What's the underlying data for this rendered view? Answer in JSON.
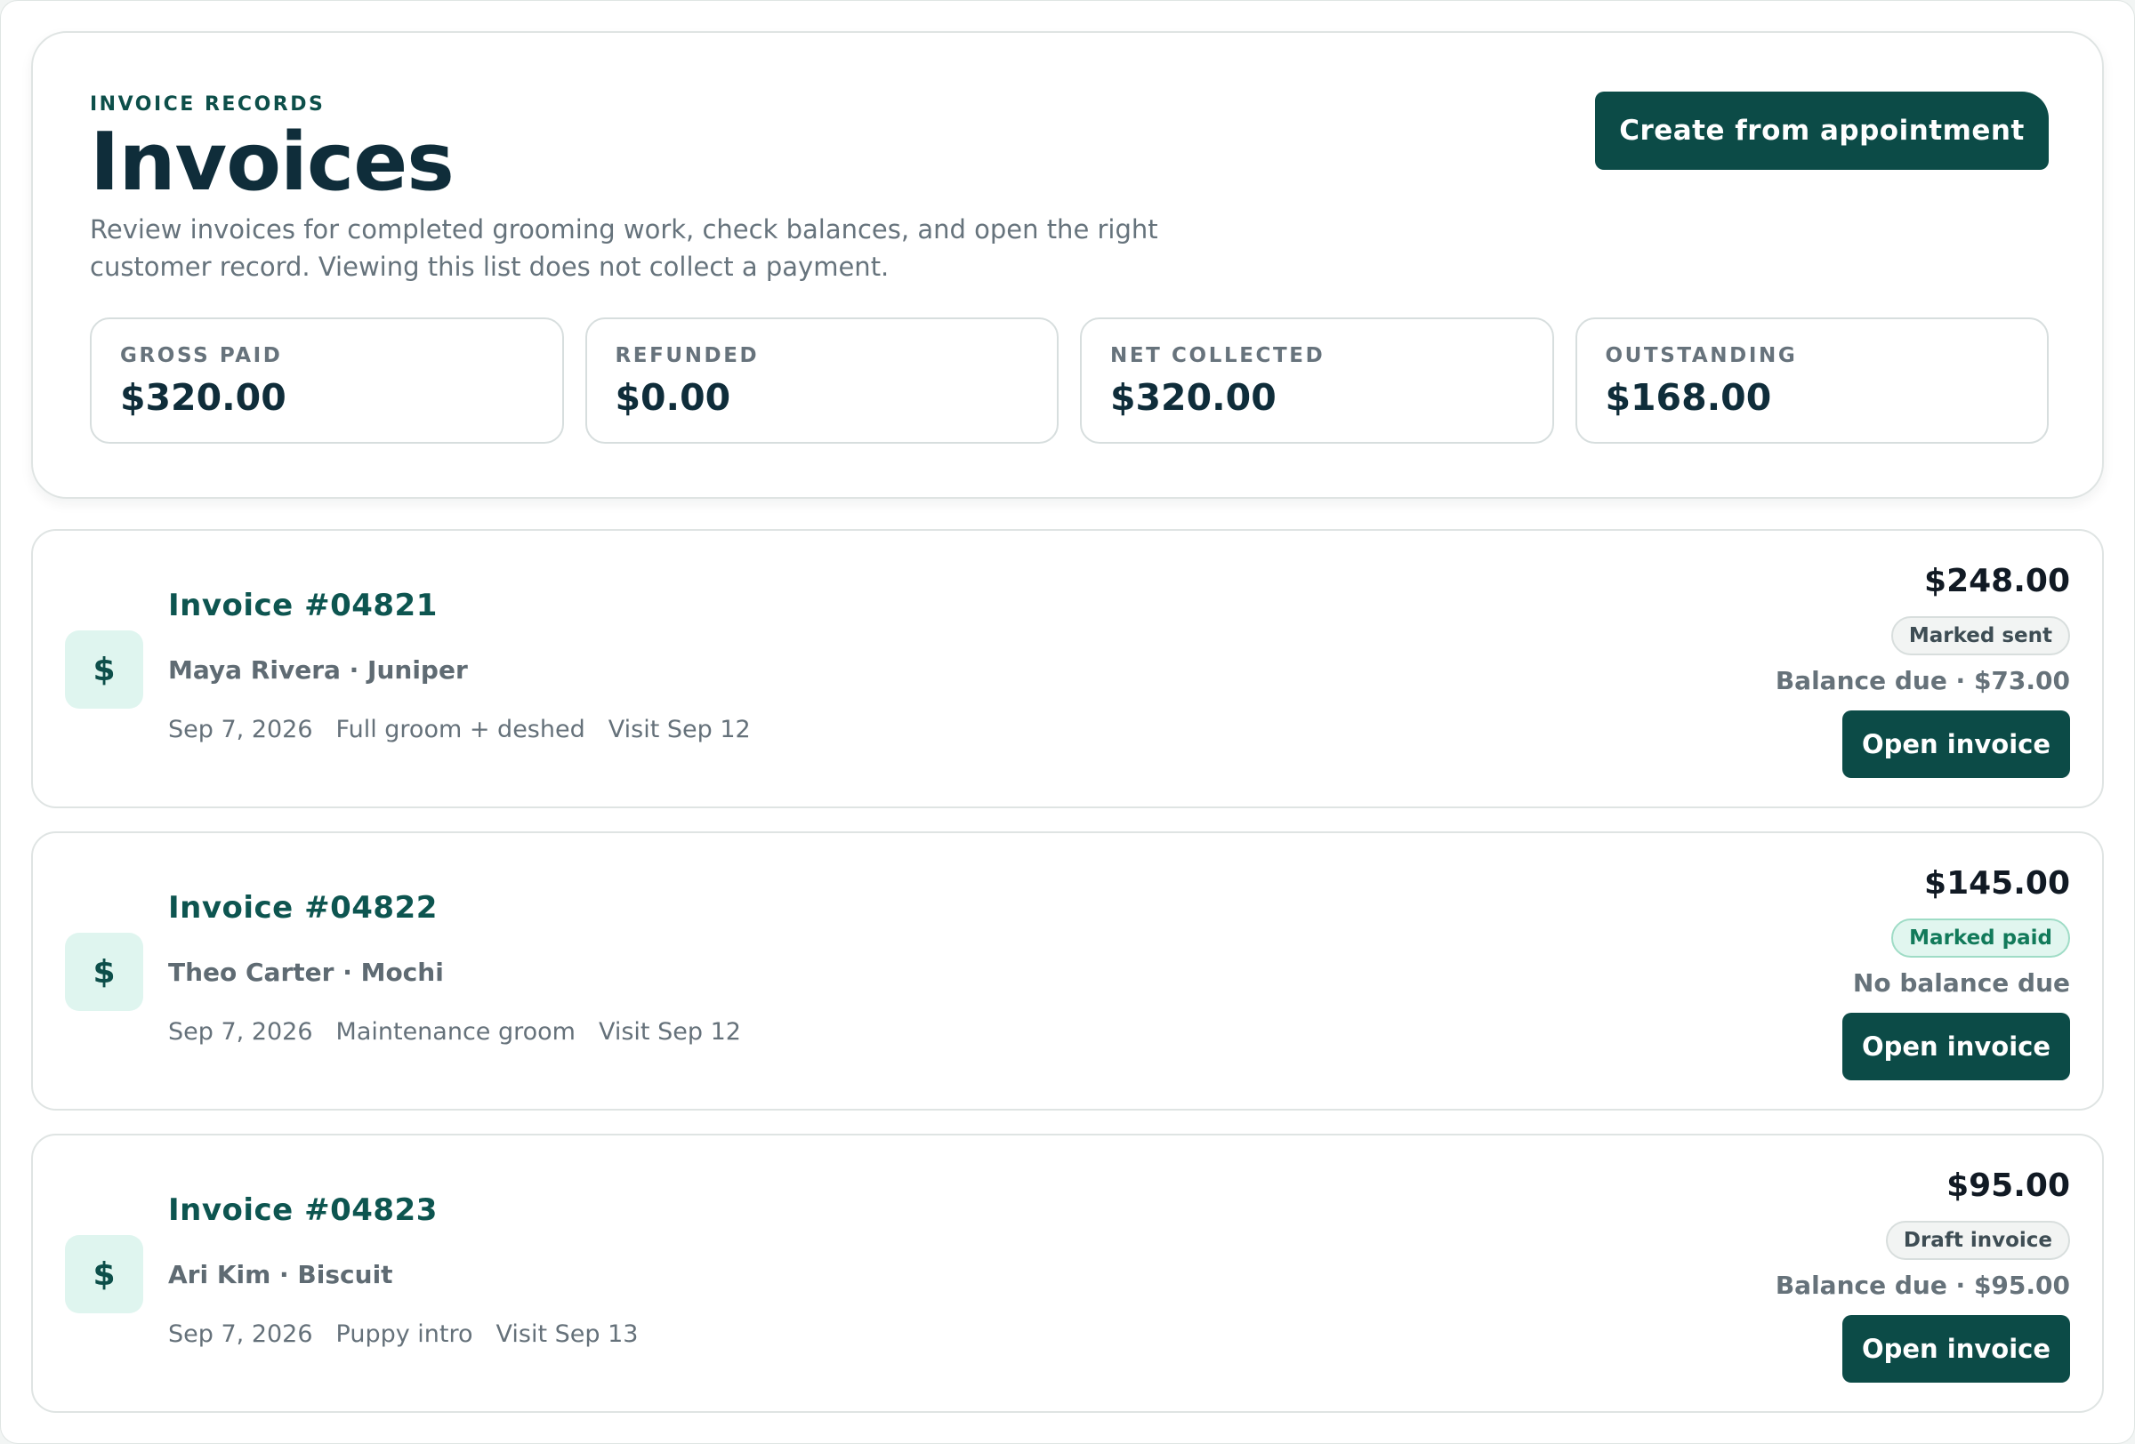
{
  "header": {
    "eyebrow": "INVOICE RECORDS",
    "title": "Invoices",
    "description": "Review invoices for completed grooming work, check balances, and open the right customer record. Viewing this list does not collect a payment.",
    "create_button_label": "Create from appointment"
  },
  "stats": [
    {
      "label": "GROSS PAID",
      "value": "$320.00"
    },
    {
      "label": "REFUNDED",
      "value": "$0.00"
    },
    {
      "label": "NET COLLECTED",
      "value": "$320.00"
    },
    {
      "label": "OUTSTANDING",
      "value": "$168.00"
    }
  ],
  "invoices": [
    {
      "icon": "dollar-icon",
      "icon_glyph": "$",
      "number": "Invoice #04821",
      "customer_pet": "Maya Rivera · Juniper",
      "date": "Sep 7, 2026",
      "service": "Full groom + deshed",
      "visit": "Visit Sep 12",
      "amount": "$248.00",
      "status": "Marked sent",
      "balance": "Balance due · $73.00",
      "open_label": "Open invoice"
    },
    {
      "icon": "dollar-icon",
      "icon_glyph": "$",
      "number": "Invoice #04822",
      "customer_pet": "Theo Carter · Mochi",
      "date": "Sep 7, 2026",
      "service": "Maintenance groom",
      "visit": "Visit Sep 12",
      "amount": "$145.00",
      "status": "Marked paid",
      "balance": "No balance due",
      "open_label": "Open invoice"
    },
    {
      "icon": "dollar-icon",
      "icon_glyph": "$",
      "number": "Invoice #04823",
      "customer_pet": "Ari Kim · Biscuit",
      "date": "Sep 7, 2026",
      "service": "Puppy intro",
      "visit": "Visit Sep 13",
      "amount": "$95.00",
      "status": "Draft invoice",
      "balance": "Balance due · $95.00",
      "open_label": "Open invoice"
    }
  ],
  "colors": {
    "brand": "#0c4b47",
    "title": "#0f2d3a",
    "paid_badge_text": "#127a5a",
    "paid_badge_bg": "#e1f6ef",
    "icon_tile_bg": "#dff5ef"
  }
}
